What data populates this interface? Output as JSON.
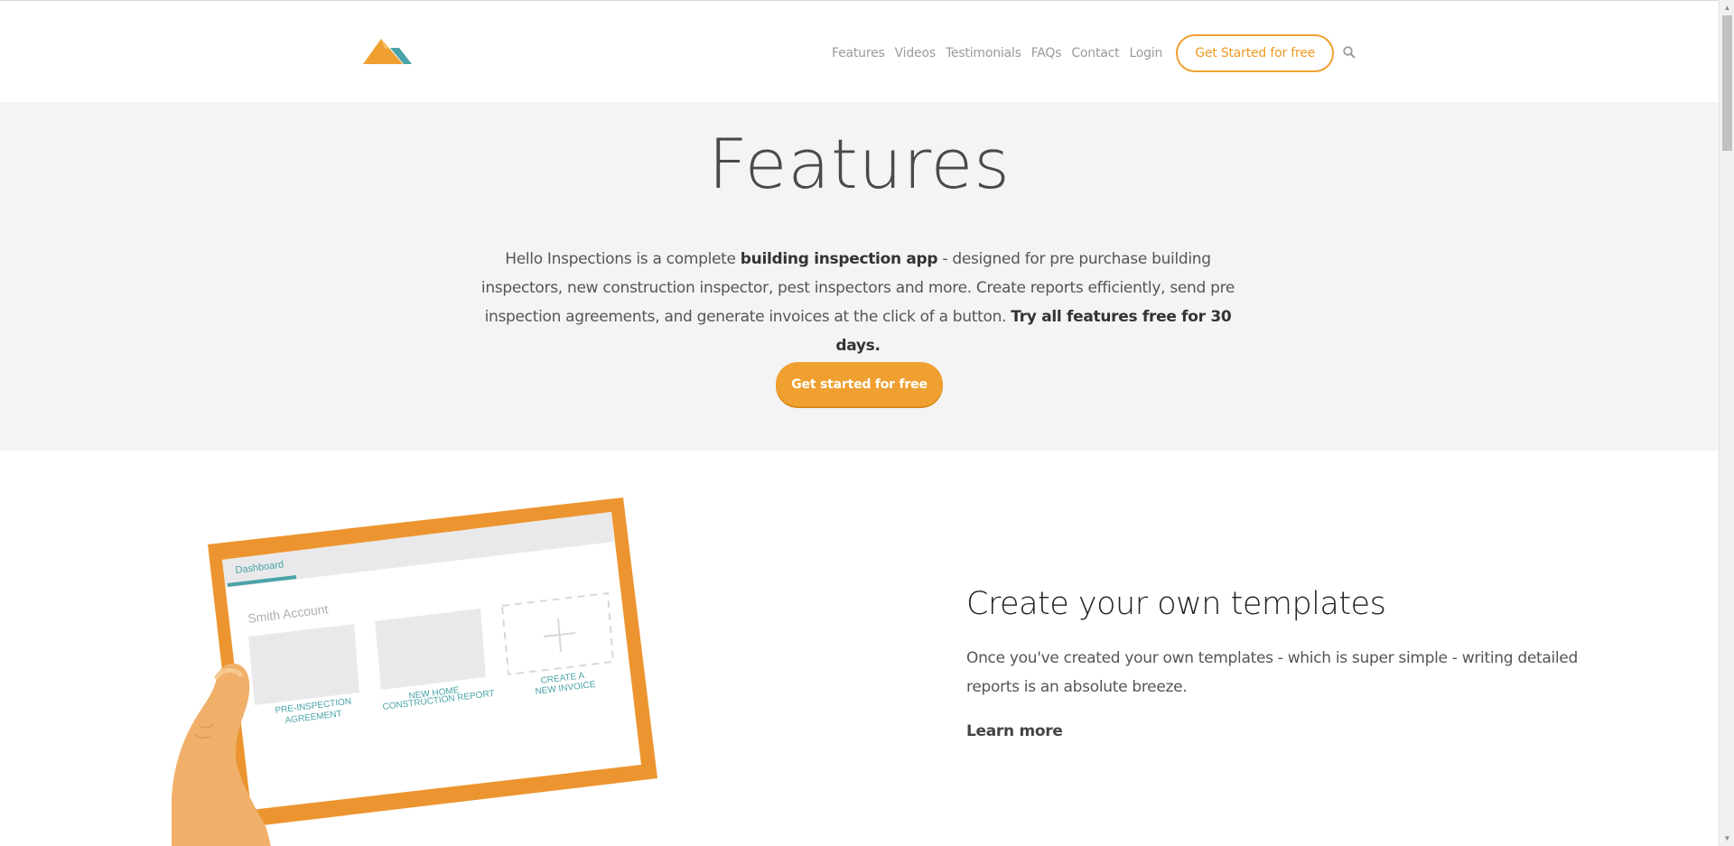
{
  "header": {
    "nav": [
      "Features",
      "Videos",
      "Testimonials",
      "FAQs",
      "Contact",
      "Login"
    ],
    "cta": "Get Started for free",
    "search_icon": "search-icon",
    "logo_icon": "mountain-logo-icon"
  },
  "hero": {
    "title": "Features",
    "intro_1": "Hello Inspections is a complete ",
    "intro_bold_1": "building inspection app",
    "intro_2": " - designed for pre purchase building inspectors, new construction inspector, pest inspectors and more. Create reports efficiently, send pre inspection agreements, and generate invoices at the click of a button. ",
    "intro_bold_2": "Try all features free for 30 days.",
    "button": "Get started for free"
  },
  "feature": {
    "title": "Create your own templates",
    "text": "Once you've created your own templates - which is super simple - writing detailed reports is an absolute breeze.",
    "link": "Learn more",
    "illustration": {
      "tab": "Dashboard",
      "account": "Smith Account",
      "card_1_line_1": "PRE-INSPECTION",
      "card_1_line_2": "AGREEMENT",
      "card_2_line_1": "NEW HOME",
      "card_2_line_2": "CONSTRUCTION REPORT",
      "card_3_line_1": "CREATE A",
      "card_3_line_2": "NEW INVOICE"
    }
  },
  "colors": {
    "accent": "#f0a030",
    "teal": "#4aa3a8",
    "hero_bg": "#f4f4f4"
  }
}
